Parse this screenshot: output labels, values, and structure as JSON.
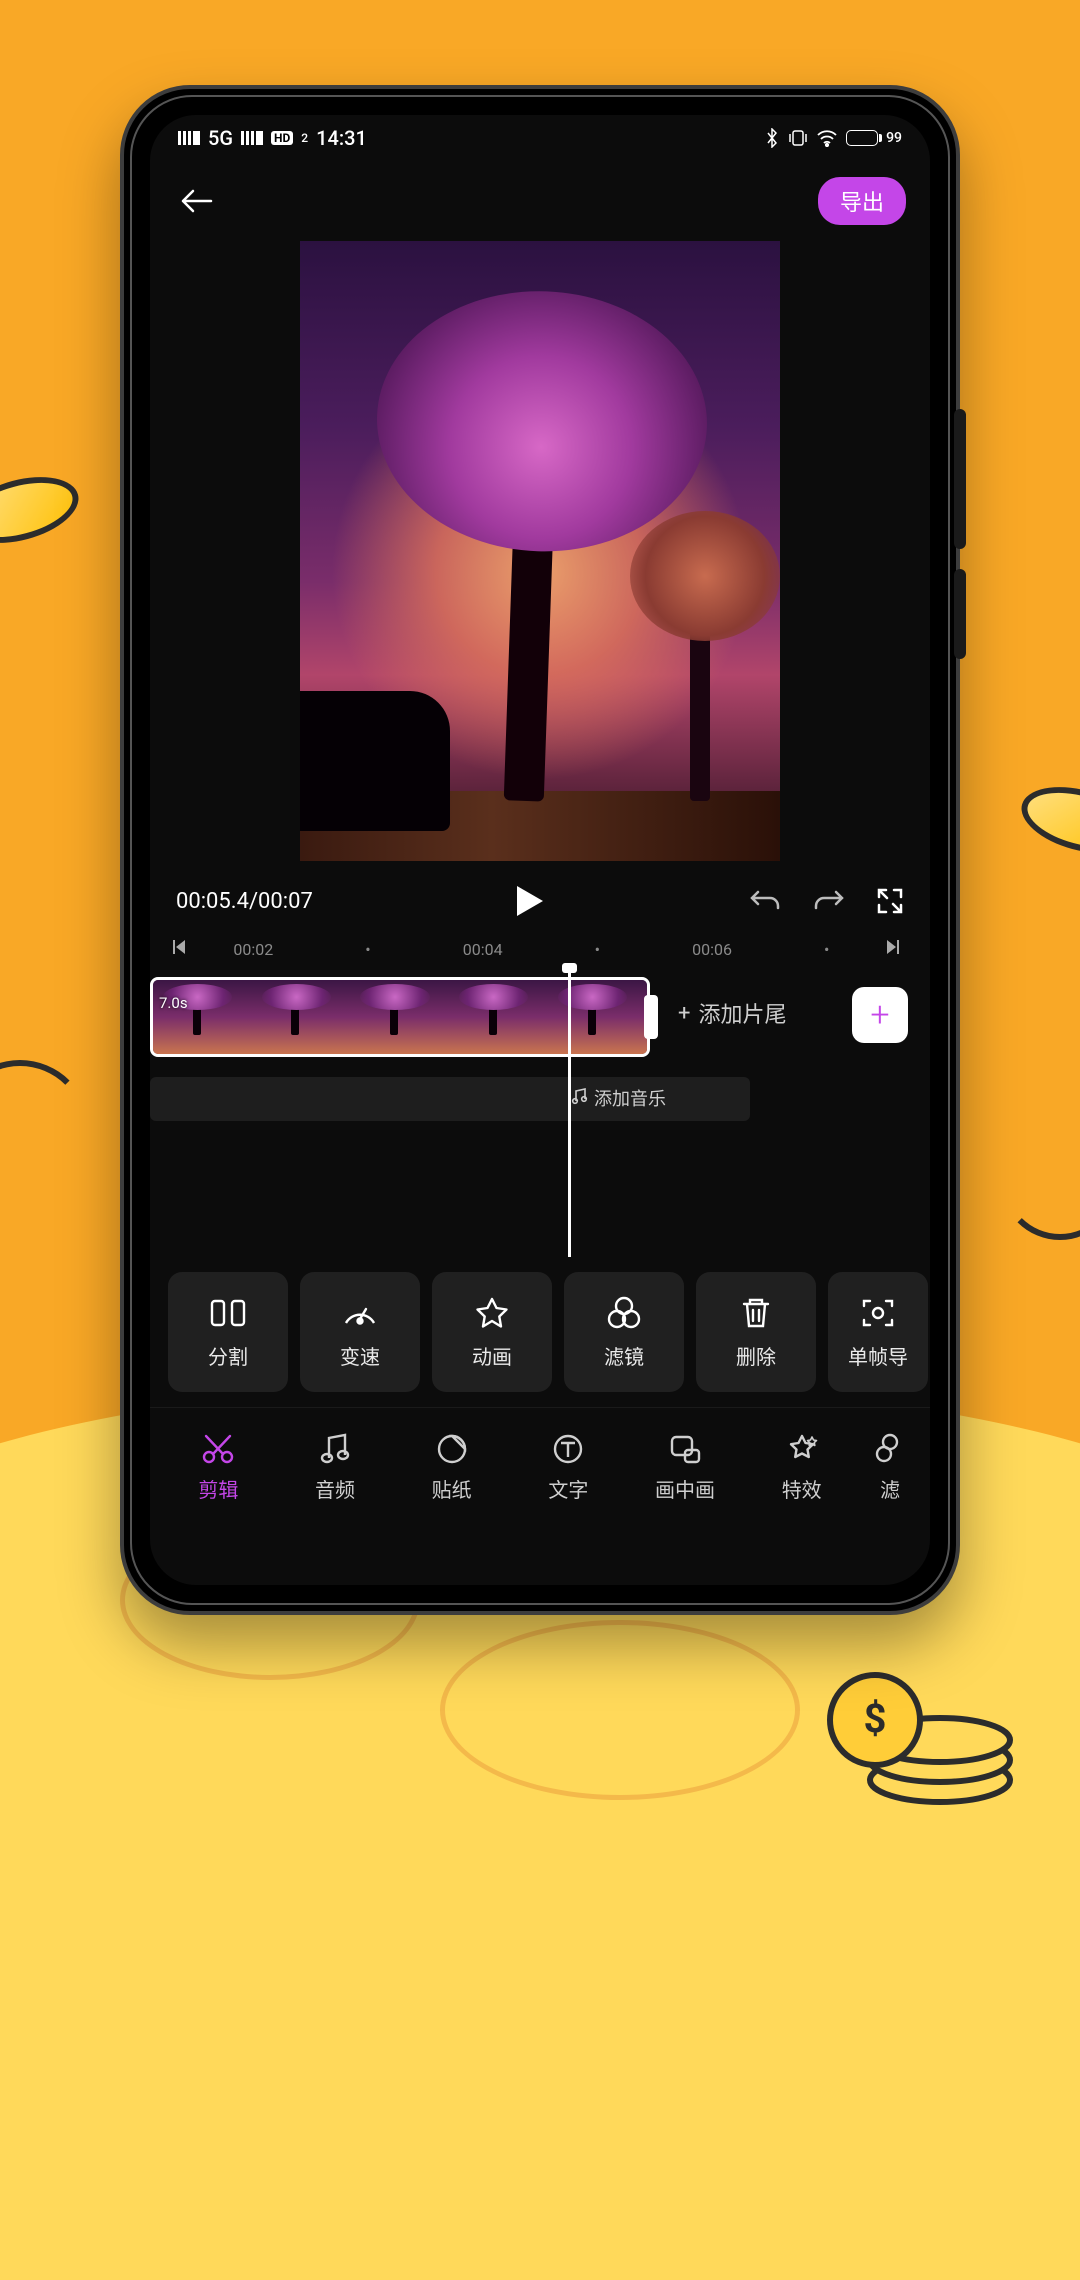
{
  "status": {
    "network": "5G",
    "hd": "HD",
    "hd_sub": "2",
    "time": "14:31",
    "battery": "99"
  },
  "header": {
    "export_label": "导出"
  },
  "player": {
    "current": "00:05.4",
    "total": "00:07"
  },
  "ruler": {
    "t1": "00:02",
    "t2": "00:04",
    "t3": "00:06"
  },
  "timeline": {
    "clip_duration": "7.0s",
    "add_ending_label": "添加片尾",
    "add_music_label": "添加音乐"
  },
  "tools": [
    {
      "id": "split",
      "label": "分割"
    },
    {
      "id": "speed",
      "label": "变速"
    },
    {
      "id": "anim",
      "label": "动画"
    },
    {
      "id": "filter",
      "label": "滤镜"
    },
    {
      "id": "delete",
      "label": "删除"
    },
    {
      "id": "frame-export",
      "label": "单帧导"
    }
  ],
  "nav": [
    {
      "id": "edit",
      "label": "剪辑"
    },
    {
      "id": "audio",
      "label": "音频"
    },
    {
      "id": "sticker",
      "label": "贴纸"
    },
    {
      "id": "text",
      "label": "文字"
    },
    {
      "id": "pip",
      "label": "画中画"
    },
    {
      "id": "fx",
      "label": "特效"
    },
    {
      "id": "filter2",
      "label": "滤"
    }
  ]
}
